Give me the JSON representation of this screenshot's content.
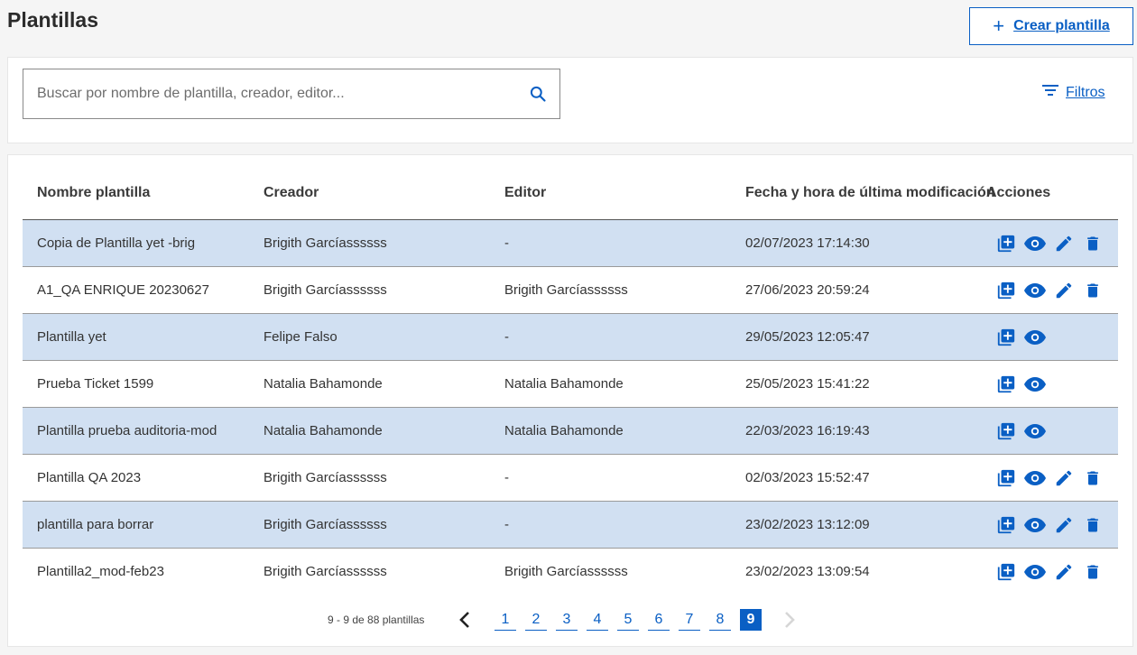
{
  "page": {
    "title": "Plantillas"
  },
  "create_button": {
    "label": "Crear plantilla"
  },
  "search": {
    "placeholder": "Buscar por nombre de plantilla, creador, editor...",
    "value": ""
  },
  "filters": {
    "label": "Filtros"
  },
  "colors": {
    "accent": "#0a5fc4",
    "row_highlight": "#d1e0f2"
  },
  "table": {
    "headers": {
      "name": "Nombre plantilla",
      "creator": "Creador",
      "editor": "Editor",
      "modified": "Fecha y hora de última modificación",
      "actions": "Acciones"
    },
    "rows": [
      {
        "name": "Copia de Plantilla yet -brig",
        "creator": "Brigith Garcíassssss",
        "editor": "-",
        "modified": "02/07/2023 17:14:30",
        "can_edit": true
      },
      {
        "name": "A1_QA ENRIQUE 20230627",
        "creator": "Brigith Garcíassssss",
        "editor": "Brigith Garcíassssss",
        "modified": "27/06/2023 20:59:24",
        "can_edit": true
      },
      {
        "name": "Plantilla yet",
        "creator": "Felipe Falso",
        "editor": "-",
        "modified": "29/05/2023 12:05:47",
        "can_edit": false
      },
      {
        "name": "Prueba Ticket 1599",
        "creator": "Natalia Bahamonde",
        "editor": "Natalia Bahamonde",
        "modified": "25/05/2023 15:41:22",
        "can_edit": false
      },
      {
        "name": "Plantilla prueba auditoria-mod",
        "creator": "Natalia Bahamonde",
        "editor": "Natalia Bahamonde",
        "modified": "22/03/2023 16:19:43",
        "can_edit": false
      },
      {
        "name": "Plantilla QA 2023",
        "creator": "Brigith Garcíassssss",
        "editor": "-",
        "modified": "02/03/2023 15:52:47",
        "can_edit": true
      },
      {
        "name": "plantilla para borrar",
        "creator": "Brigith Garcíassssss",
        "editor": "-",
        "modified": "23/02/2023 13:12:09",
        "can_edit": true
      },
      {
        "name": "Plantilla2_mod-feb23",
        "creator": "Brigith Garcíassssss",
        "editor": "Brigith Garcíassssss",
        "modified": "23/02/2023 13:09:54",
        "can_edit": true
      }
    ]
  },
  "pagination": {
    "info": "9 - 9 de 88 plantillas",
    "pages": [
      "1",
      "2",
      "3",
      "4",
      "5",
      "6",
      "7",
      "8",
      "9"
    ],
    "current": "9"
  },
  "icons": {
    "create": "plus-icon",
    "search": "search-icon",
    "filters": "filter-list-icon",
    "row_actions": [
      "duplicate-icon",
      "view-icon",
      "edit-icon",
      "delete-icon"
    ],
    "prev": "chevron-left-icon",
    "next": "chevron-right-icon"
  }
}
